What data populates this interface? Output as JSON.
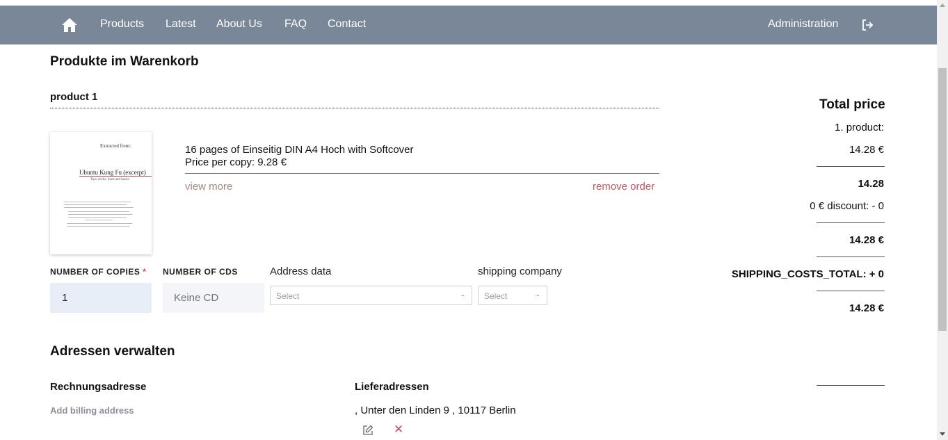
{
  "nav": {
    "links": [
      "Products",
      "Latest",
      "About Us",
      "FAQ",
      "Contact"
    ],
    "admin": "Administration"
  },
  "cart": {
    "heading": "Produkte im Warenkorb",
    "product_title": "product 1",
    "thumbnail": {
      "extracted": "Extracted from:",
      "book_title": "Ubuntu Kung Fu (excerpt)",
      "subtitle": "Tips, tricks, hints and hacks"
    },
    "description": "16 pages of Einseitig DIN A4 Hoch with Softcover",
    "price_per_copy": "Price per copy: 9.28 €",
    "view_more": "view more",
    "remove_order": "remove order"
  },
  "form": {
    "copies_label": "NUMBER OF COPIES",
    "copies_required": "*",
    "copies_value": "1",
    "cds_label": "NUMBER OF CDS",
    "cds_placeholder": "Keine CD",
    "address_label": "Address data",
    "address_select": "Select",
    "shipping_label": "shipping company",
    "shipping_select": "Select"
  },
  "total": {
    "title": "Total price",
    "product_line": "1. product:",
    "product_price": "14.28 €",
    "subtotal": "14.28",
    "discount": "0 € discount: - 0",
    "after_discount": "14.28 €",
    "shipping": "SHIPPING_COSTS_TOTAL: + 0",
    "final": "14.28 €"
  },
  "addresses": {
    "heading": "Adressen verwalten",
    "billing_heading": "Rechnungsadresse",
    "add_billing": "Add billing address",
    "delivery_heading": "Lieferadressen",
    "delivery_line": ", Unter den Linden 9 , 10117 Berlin"
  },
  "colors": {
    "navbar": "#7a8799",
    "view_more": "#a1887f",
    "remove": "#c0575f",
    "input_bg": "#e8eef7"
  }
}
